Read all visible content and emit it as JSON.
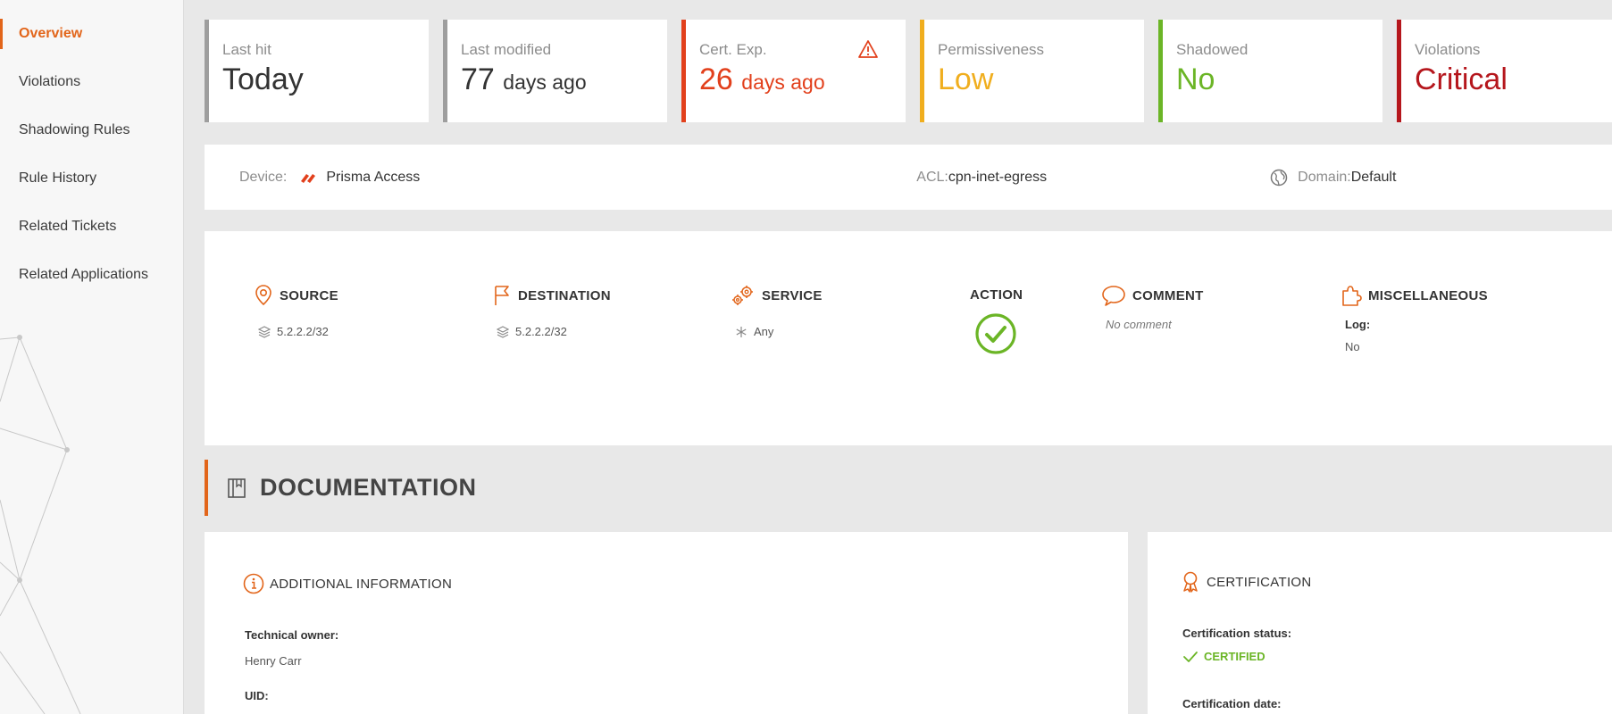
{
  "sidebar": {
    "items": [
      {
        "label": "Overview",
        "active": true
      },
      {
        "label": "Violations"
      },
      {
        "label": "Shadowing Rules"
      },
      {
        "label": "Rule History"
      },
      {
        "label": "Related Tickets"
      },
      {
        "label": "Related Applications"
      }
    ]
  },
  "kpis": {
    "last_hit": {
      "label": "Last hit",
      "value": "Today",
      "color": "#9e9e9e"
    },
    "last_modified": {
      "label": "Last modified",
      "value": "77",
      "unit": "days ago",
      "color": "#9e9e9e"
    },
    "cert_exp": {
      "label": "Cert. Exp.",
      "value": "26",
      "unit": "days ago",
      "color": "#e2401c",
      "icon": "warning-icon"
    },
    "permissiveness": {
      "label": "Permissiveness",
      "value": "Low",
      "color": "#f0ae1e"
    },
    "shadowed": {
      "label": "Shadowed",
      "value": "No",
      "color": "#6bb526"
    },
    "violations": {
      "label": "Violations",
      "value": "Critical",
      "color": "#b5161c"
    }
  },
  "device": {
    "device_label": "Device:",
    "device_value": "Prisma Access",
    "device_icon": "paloalto-logo-icon",
    "acl_label": "ACL:",
    "acl_value": "cpn-inet-egress",
    "domain_label": "Domain:",
    "domain_value": "Default",
    "domain_icon": "globe-icon"
  },
  "rule": {
    "source": {
      "title": "SOURCE",
      "value": "5.2.2.2/32"
    },
    "destination": {
      "title": "DESTINATION",
      "value": "5.2.2.2/32"
    },
    "service": {
      "title": "SERVICE",
      "value": "Any"
    },
    "action": {
      "title": "ACTION",
      "icon": "check-circle-icon",
      "color": "#6bb526"
    },
    "comment": {
      "title": "COMMENT",
      "value": "No comment"
    },
    "misc": {
      "title": "MISCELLANEOUS",
      "log_label": "Log:",
      "log_value": "No"
    }
  },
  "documentation": {
    "title": "DOCUMENTATION",
    "additional": {
      "title": "ADDITIONAL INFORMATION",
      "owner_label": "Technical owner:",
      "owner_value": "Henry Carr",
      "uid_label": "UID:"
    },
    "certification": {
      "title": "CERTIFICATION",
      "status_label": "Certification status:",
      "status_value": "CERTIFIED",
      "date_label": "Certification date:"
    }
  },
  "colors": {
    "accent": "#e2651a",
    "success": "#6bb526"
  }
}
